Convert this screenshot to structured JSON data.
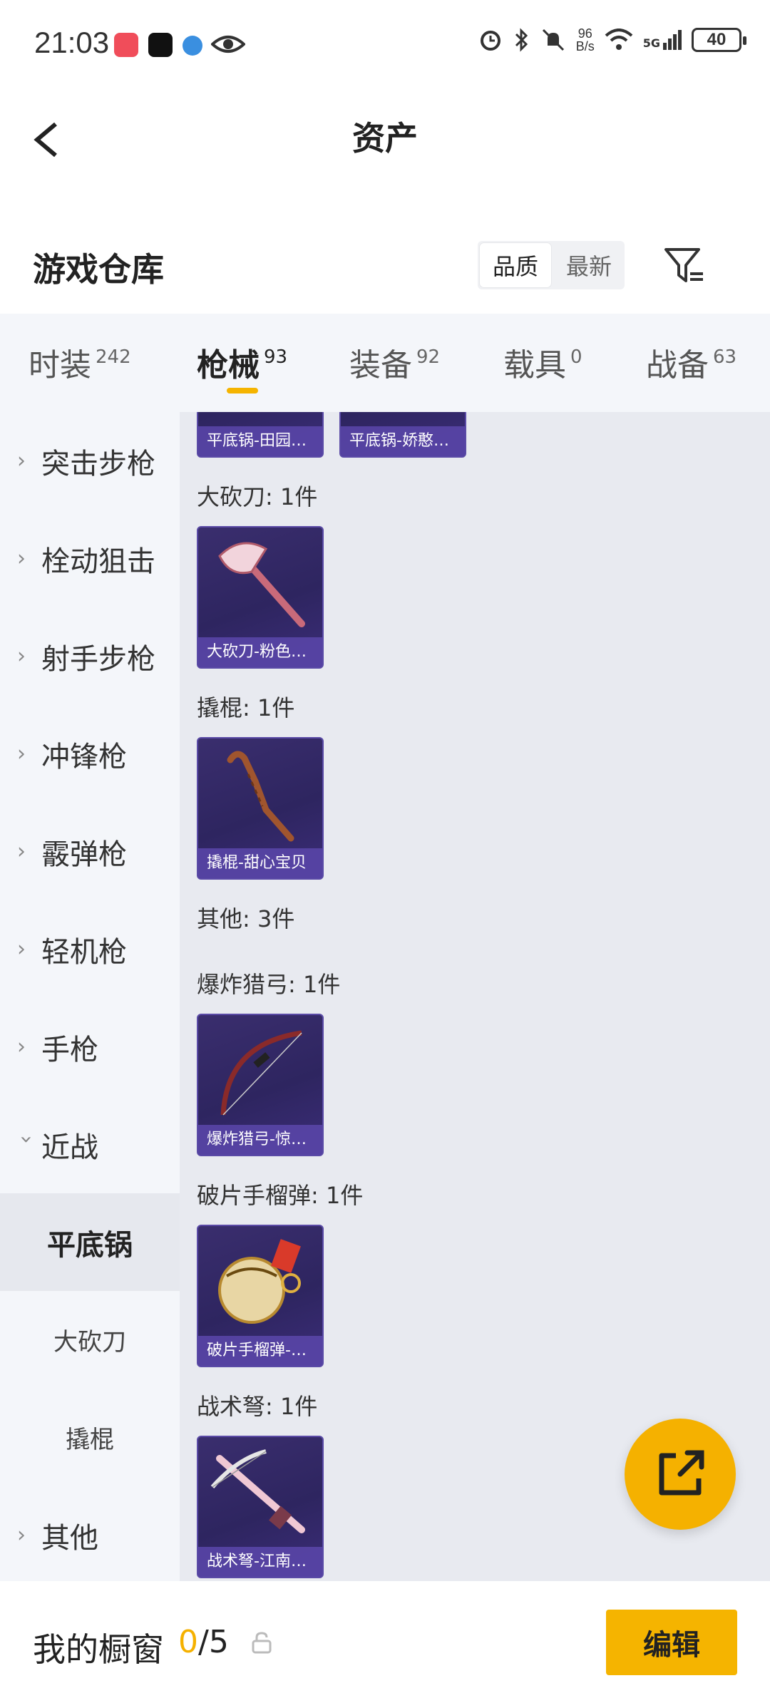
{
  "status_bar": {
    "time": "21:03",
    "net_speed_value": "96",
    "net_speed_unit": "B/s",
    "signal": "5G",
    "battery": "40"
  },
  "nav": {
    "title": "资产"
  },
  "warehouse": {
    "title": "游戏仓库",
    "sort_options": [
      "品质",
      "最新"
    ],
    "sort_active": "品质"
  },
  "tabs": [
    {
      "label": "时装",
      "count": "242"
    },
    {
      "label": "枪械",
      "count": "93"
    },
    {
      "label": "装备",
      "count": "92"
    },
    {
      "label": "载具",
      "count": "0"
    },
    {
      "label": "战备",
      "count": "63"
    }
  ],
  "active_tab": "枪械",
  "sidebar": {
    "items": [
      "突击步枪",
      "栓动狙击",
      "射手步枪",
      "冲锋枪",
      "霰弹枪",
      "轻机枪",
      "手枪",
      "近战"
    ],
    "sub_items": [
      "平底锅",
      "大砍刀",
      "撬棍"
    ],
    "active_sub": "平底锅",
    "last_item": "其他"
  },
  "content": {
    "top_cards": [
      "平底锅-田园…",
      "平底锅-娇憨…"
    ],
    "groups": [
      {
        "heading": "大砍刀: 1件",
        "card": "大砍刀-粉色…"
      },
      {
        "heading": "撬棍: 1件",
        "card": "撬棍-甜心宝贝"
      },
      {
        "heading": "其他: 3件"
      },
      {
        "heading": "爆炸猎弓: 1件",
        "card": "爆炸猎弓-惊…"
      },
      {
        "heading": "破片手榴弹: 1件",
        "card": "破片手榴弹-…"
      },
      {
        "heading": "战术弩: 1件",
        "card": "战术弩-江南…"
      }
    ]
  },
  "bottom": {
    "title": "我的橱窗",
    "count_current": "0",
    "count_total": "/5",
    "edit_label": "编辑"
  },
  "colors": {
    "accent": "#f5b400",
    "card_bg": "#2e2560",
    "content_bg": "#e8eaf0"
  }
}
